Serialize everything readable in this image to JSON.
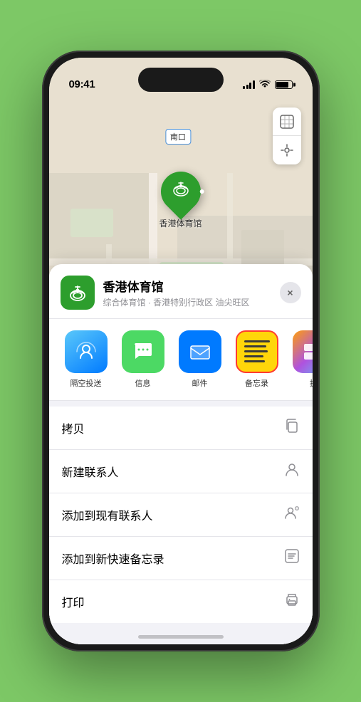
{
  "status_bar": {
    "time": "09:41",
    "location_arrow": "▶"
  },
  "map": {
    "label": "南口",
    "marker_label": "香港体育馆"
  },
  "map_controls": {
    "map_btn": "🗺",
    "location_btn": "➤"
  },
  "location_card": {
    "name": "香港体育馆",
    "subtitle": "综合体育馆 · 香港特别行政区 油尖旺区",
    "close_label": "×"
  },
  "share_items": [
    {
      "id": "airdrop",
      "label": "隔空投送",
      "icon_type": "airdrop"
    },
    {
      "id": "messages",
      "label": "信息",
      "icon_type": "messages"
    },
    {
      "id": "mail",
      "label": "邮件",
      "icon_type": "mail"
    },
    {
      "id": "notes",
      "label": "备忘录",
      "icon_type": "notes"
    },
    {
      "id": "more",
      "label": "提",
      "icon_type": "more"
    }
  ],
  "action_items": [
    {
      "id": "copy",
      "label": "拷贝",
      "icon": "⎘"
    },
    {
      "id": "add-contact",
      "label": "新建联系人",
      "icon": "👤"
    },
    {
      "id": "add-existing",
      "label": "添加到现有联系人",
      "icon": "👤+"
    },
    {
      "id": "add-note",
      "label": "添加到新快速备忘录",
      "icon": "📋"
    },
    {
      "id": "print",
      "label": "打印",
      "icon": "🖨"
    }
  ],
  "home_indicator": {}
}
